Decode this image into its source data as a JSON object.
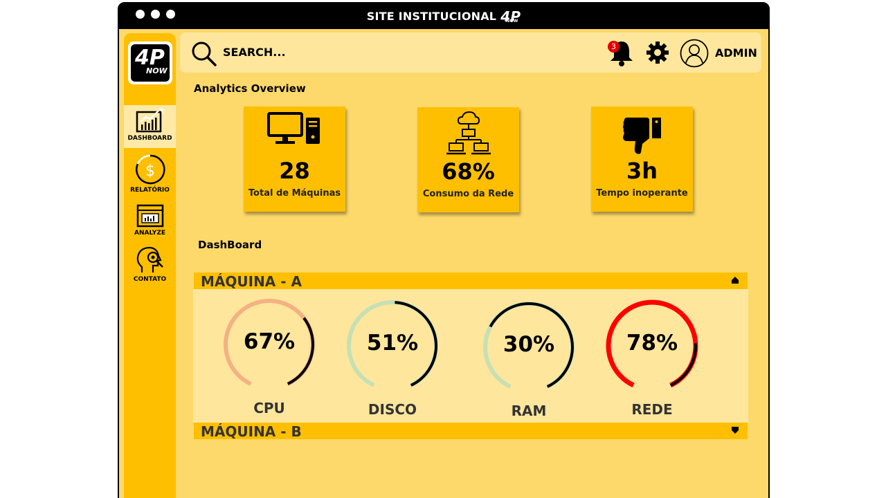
{
  "window": {
    "title": "SITE INSTITUCIONAL",
    "logo_text": "4P",
    "logo_subtext": "NOW"
  },
  "sidebar": {
    "logo_text": "4P",
    "logo_subtext": "NOW",
    "items": [
      {
        "label": "DASHBOARD",
        "icon": "chart-icon",
        "active": true
      },
      {
        "label": "RELATÓRIO",
        "icon": "dollar-icon",
        "active": false
      },
      {
        "label": "ANALYZE",
        "icon": "analyze-icon",
        "active": false
      },
      {
        "label": "CONTATO",
        "icon": "contact-icon",
        "active": false
      }
    ]
  },
  "topbar": {
    "search_placeholder": "SEARCH...",
    "notification_count": "3",
    "user_name": "ADMIN"
  },
  "overview": {
    "title": "Analytics Overview",
    "cards": [
      {
        "value": "28",
        "label": "Total de Máquinas",
        "icon": "computer-icon"
      },
      {
        "value": "68%",
        "label": "Consumo da Rede",
        "icon": "network-icon"
      },
      {
        "value": "3h",
        "label": "Tempo inoperante",
        "icon": "thumbs-down-icon"
      }
    ]
  },
  "dashboard": {
    "title": "DashBoard",
    "machines": [
      {
        "name": "MÁQUINA - A",
        "expanded": true,
        "gauges": [
          {
            "label": "CPU",
            "value": "67%",
            "fraction": 0.67,
            "track_color": "#f4b183",
            "fill_color": "#000000"
          },
          {
            "label": "DISCO",
            "value": "51%",
            "fraction": 0.51,
            "track_color": "#c5e0b4",
            "fill_color": "#000000"
          },
          {
            "label": "RAM",
            "value": "30%",
            "fraction": 0.3,
            "track_color": "#c5e0b4",
            "fill_color": "#000000"
          },
          {
            "label": "REDE",
            "value": "78%",
            "fraction": 0.78,
            "track_color": "#ff0000",
            "fill_color": "#000000"
          }
        ]
      },
      {
        "name": "MÁQUINA - B",
        "expanded": false
      }
    ]
  },
  "colors": {
    "background": "#fdd96b",
    "accent": "#fdbf00",
    "panel": "#fee69d",
    "titlebar": "#000000",
    "alert": "#e00000"
  }
}
